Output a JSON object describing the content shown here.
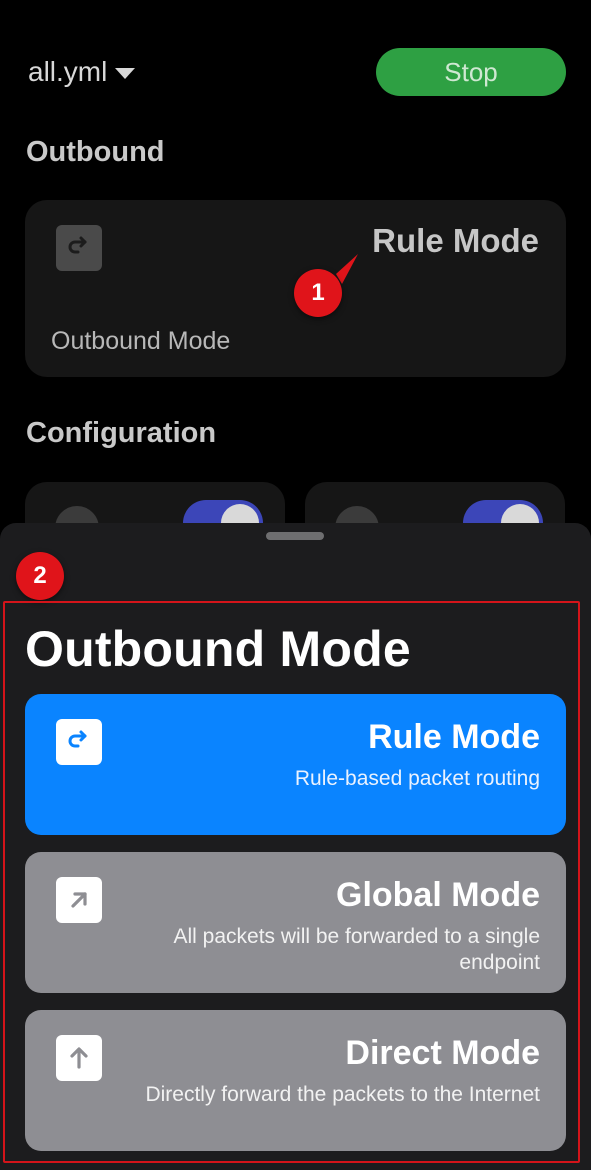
{
  "header": {
    "config_name": "all.yml",
    "stop_label": "Stop"
  },
  "sections": {
    "outbound": "Outbound",
    "configuration": "Configuration"
  },
  "outbound_card": {
    "icon": "redirect-icon",
    "value": "Rule Mode",
    "caption": "Outbound Mode"
  },
  "config_cards": [
    {
      "icon": "partial-icon",
      "toggle_on": true
    },
    {
      "icon": "partial-icon",
      "toggle_on": true
    }
  ],
  "annotations": {
    "marker_1": "1",
    "marker_2": "2"
  },
  "sheet": {
    "title": "Outbound Mode",
    "options": [
      {
        "icon": "redirect-icon",
        "title": "Rule Mode",
        "description": "Rule-based packet routing",
        "selected": true
      },
      {
        "icon": "arrow-up-right-icon",
        "title": "Global Mode",
        "description": "All packets will be forwarded to a single endpoint",
        "selected": false
      },
      {
        "icon": "arrow-up-icon",
        "title": "Direct Mode",
        "description": "Directly forward the packets to the Internet",
        "selected": false
      }
    ]
  },
  "colors": {
    "selected": "#0a84ff",
    "unselected": "#8e8e93",
    "stop_button": "#2ea043",
    "toggle": "#3c46b8",
    "annotation": "#e0141a"
  }
}
